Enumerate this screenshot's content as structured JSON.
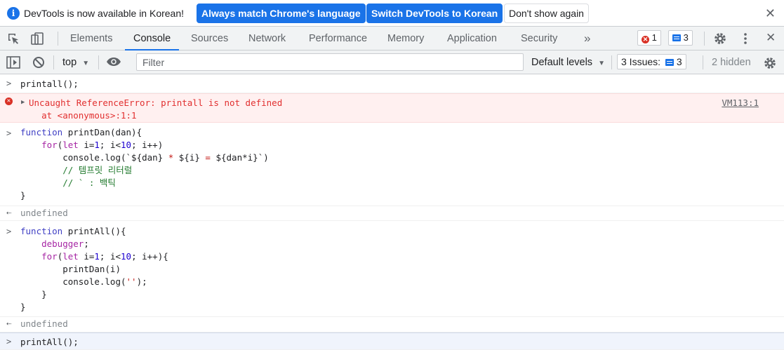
{
  "infobar": {
    "message": "DevTools is now available in Korean!",
    "btn_match": "Always match Chrome's language",
    "btn_switch": "Switch DevTools to Korean",
    "btn_dismiss": "Don't show again"
  },
  "tabs": [
    "Elements",
    "Console",
    "Sources",
    "Network",
    "Performance",
    "Memory",
    "Application",
    "Security"
  ],
  "active_tab": "Console",
  "more_tabs": "»",
  "error_count": "1",
  "message_count": "3",
  "console_toolbar": {
    "context": "top",
    "filter_placeholder": "Filter",
    "levels": "Default levels",
    "issues_label": "3 Issues:",
    "issues_count": "3",
    "hidden": "2 hidden"
  },
  "console": {
    "cmd1": "printall();",
    "error_msg": "Uncaught ReferenceError: printall is not defined",
    "error_at": "    at <anonymous>:1:1",
    "error_link": "VM113:1",
    "fn1": {
      "l1a": "function",
      "l1b": " printDan(dan){",
      "l2a": "    for",
      "l2b": "(",
      "l2c": "let",
      "l2d": " i=",
      "l2e": "1",
      "l2f": "; i<",
      "l2g": "10",
      "l2h": "; i++)",
      "l3a": "        console.log(`${dan}",
      "l3b": " * ",
      "l3c": "${i}",
      "l3d": " = ",
      "l3e": "${dan*i}",
      "l3f": "`)",
      "l4": "        // 템프릿 리터럴",
      "l5": "        // ` : 백틱",
      "l6": "}"
    },
    "ret1": "undefined",
    "fn2": {
      "l1a": "function",
      "l1b": " printAll(){",
      "l2": "    debugger",
      "l2b": ";",
      "l3a": "    for",
      "l3b": "(",
      "l3c": "let",
      "l3d": " i=",
      "l3e": "1",
      "l3f": "; i<",
      "l3g": "10",
      "l3h": "; i++){",
      "l4": "        printDan(i)",
      "l5a": "        console.log(",
      "l5b": "''",
      "l5c": ");",
      "l6": "    }",
      "l7": "}"
    },
    "ret2": "undefined",
    "cmd_last": "printAll();"
  }
}
